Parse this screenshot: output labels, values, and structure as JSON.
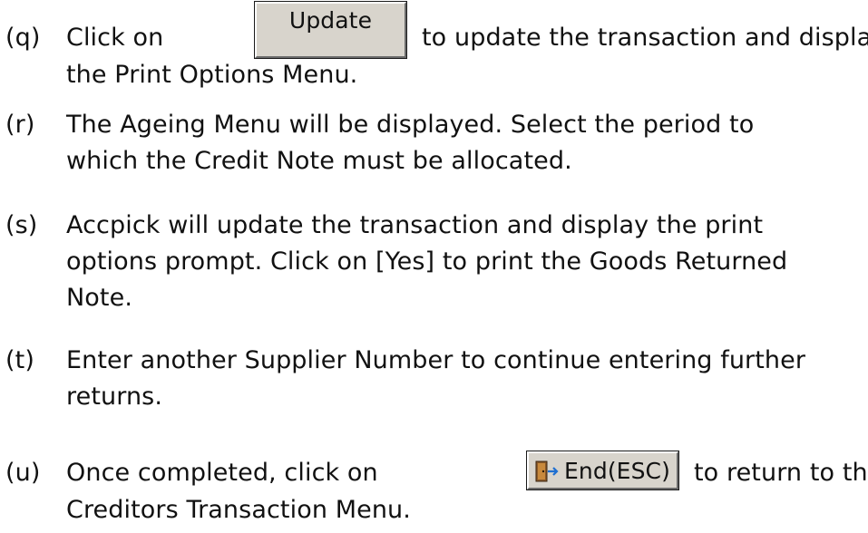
{
  "steps": [
    {
      "marker": "(q)",
      "lines": [
        {
          "before": "Click on",
          "after": "to update the transaction and display"
        },
        "the Print Options Menu."
      ],
      "button": {
        "label": "Update"
      }
    },
    {
      "marker": "(r)",
      "lines": [
        "The Ageing Menu will be displayed.  Select the period to",
        "which the Credit Note must be allocated."
      ]
    },
    {
      "marker": "(s)",
      "lines": [
        "Accpick will update the transaction and display the print",
        "options prompt.  Click on [Yes] to print the Goods Returned",
        "Note."
      ]
    },
    {
      "marker": "(t)",
      "lines": [
        "Enter another Supplier Number to continue entering further",
        "returns."
      ]
    },
    {
      "marker": "(u)",
      "lines": [
        {
          "before": "Once completed, click on",
          "after": "to return to the"
        },
        "Creditors Transaction Menu."
      ],
      "button": {
        "label": "End(ESC)",
        "icon": "exit-door-icon"
      }
    }
  ]
}
